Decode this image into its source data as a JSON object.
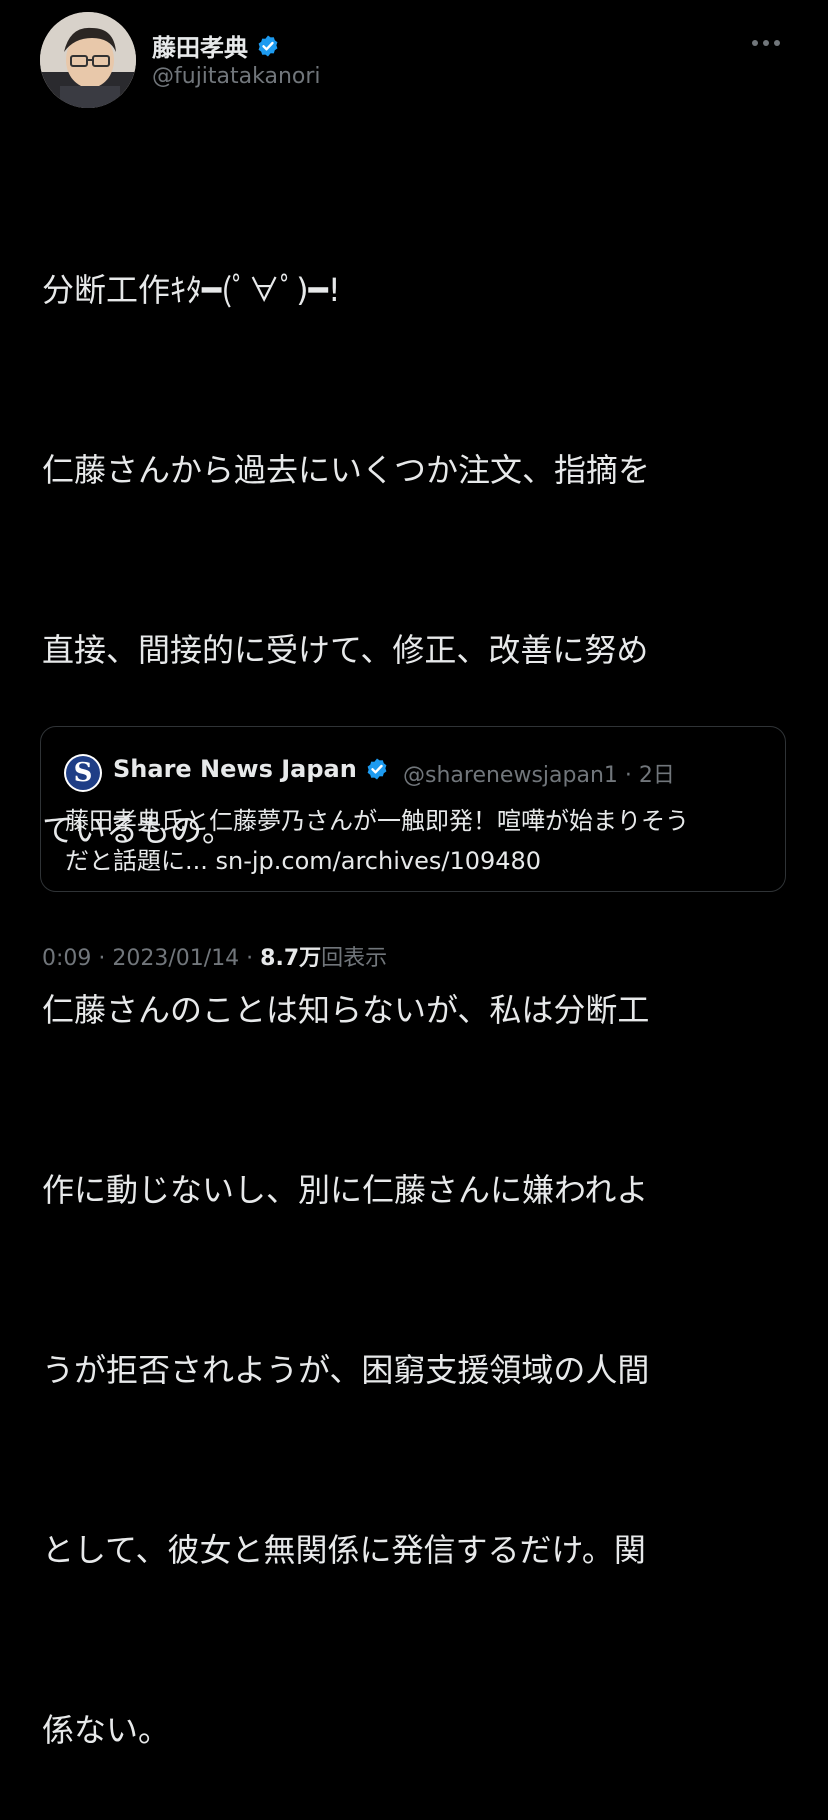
{
  "author": {
    "name": "藤田孝典",
    "handle": "@fujitatakanori",
    "verified": true,
    "verified_color": "#1d9bf0"
  },
  "more_icon": "more-horizontal-icon",
  "tweet": {
    "lines": [
      "分断工作ｷﾀ━(ﾟ∀ﾟ)━!",
      "仁藤さんから過去にいくつか注文、指摘を",
      "直接、間接的に受けて、修正、改善に努め",
      "ているもの。",
      "仁藤さんのことは知らないが、私は分断工",
      "作に動じないし、別に仁藤さんに嫌われよ",
      "うが拒否されようが、困窮支援領域の人間",
      "として、彼女と無関係に発信するだけ。関",
      "係ない。"
    ]
  },
  "quote": {
    "avatar_letter": "S",
    "name": "Share News Japan",
    "meta": "@sharenewsjapan1 · 2日",
    "text_line1": "藤田孝典氏と仁藤夢乃さんが一触即発！喧嘩が始まりそう",
    "text_line2": "だと話題に... sn-jp.com/archives/109480"
  },
  "footer": {
    "time_date": "0:09 · 2023/01/14 · ",
    "views_count": "8.7万",
    "views_label": "回表示"
  }
}
